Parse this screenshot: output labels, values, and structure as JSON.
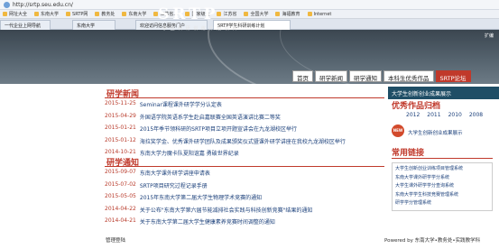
{
  "browser": {
    "url": "http://srtp.seu.edu.cn/",
    "bookmarks": [
      "网址大全",
      "东南大学",
      "SRTP网",
      "教务处",
      "东南大学",
      "江苏省人",
      "国家级大",
      "江苏省",
      "全国大学",
      "海福教育",
      "Internet"
    ],
    "tabs": [
      "一代企业上网导航",
      "东南大学",
      "欢迎访问信息服务门户",
      "SRTP学生科研训练计划"
    ]
  },
  "header": {
    "logo": "SRTP",
    "subtitle": "学 生 科 研 训 练 计 划 项 目",
    "kuanbian": "扩编",
    "nav": [
      {
        "label": "首页",
        "active": false
      },
      {
        "label": "研学新闻",
        "active": false
      },
      {
        "label": "研学通知",
        "active": false
      },
      {
        "label": "本科生优秀作品",
        "active": false
      },
      {
        "label": "SRTP论坛",
        "active": true
      }
    ],
    "right_strip": "大学生创新创业成果展示"
  },
  "news": {
    "title": "研学新闻",
    "items": [
      {
        "date": "2015-11-25",
        "title": "Seminar课程课外研学学分认定表"
      },
      {
        "date": "2015-04-29",
        "title": "外国语学院英语系学生赴启嘉联赛全国英语演讲比赛二等奖"
      },
      {
        "date": "2015-01-21",
        "title": "2015年季节领科研的SRTP项目立项开题宣讲会在九龙湖校区举行"
      },
      {
        "date": "2015-01-12",
        "title": "海拉奖学金、优秀课外研学团队及成果颁奖仪式暨课外研学讲座在我校九龙湖校区举行"
      },
      {
        "date": "2014-10-21",
        "title": "东南大学力魔卡队夏阳谊嘉 勇破世界纪录"
      }
    ]
  },
  "notices": {
    "title": "研学通知",
    "items": [
      {
        "date": "2015-09-07",
        "title": "东南大学课外研学讲座申请表"
      },
      {
        "date": "2015-07-02",
        "title": "SRTP项目研究过程记录手册"
      },
      {
        "date": "2015-05-05",
        "title": "2015年东南大学第二届大学生物理学术竞赛的通知"
      },
      {
        "date": "2014-04-22",
        "title": "关于公布\"东南大学第六届节能减排社会实践与科技创新竞赛\"结果的通知"
      },
      {
        "date": "2014-04-21",
        "title": "关于东南大学第二届大学生健康素养竞赛时间调整的通知"
      }
    ]
  },
  "sidebar": {
    "works_title": "优秀作品归档",
    "years": [
      "2012",
      "2011",
      "2010",
      "2008"
    ],
    "badge": "NEW",
    "showcase_link": "大学生创新创业成果展示",
    "links_title": "常用链接",
    "links": [
      "大学生创新创业训练项目管理系统",
      "东南大学课外研学学分系统",
      "大学生课外研学学分查询系统",
      "东南大学学生科技竞赛管理系统",
      "研学学分管理系统"
    ]
  },
  "footer": {
    "left": "管理登陆",
    "right": "Powered by 东南大学•教务处•实践教学科"
  }
}
